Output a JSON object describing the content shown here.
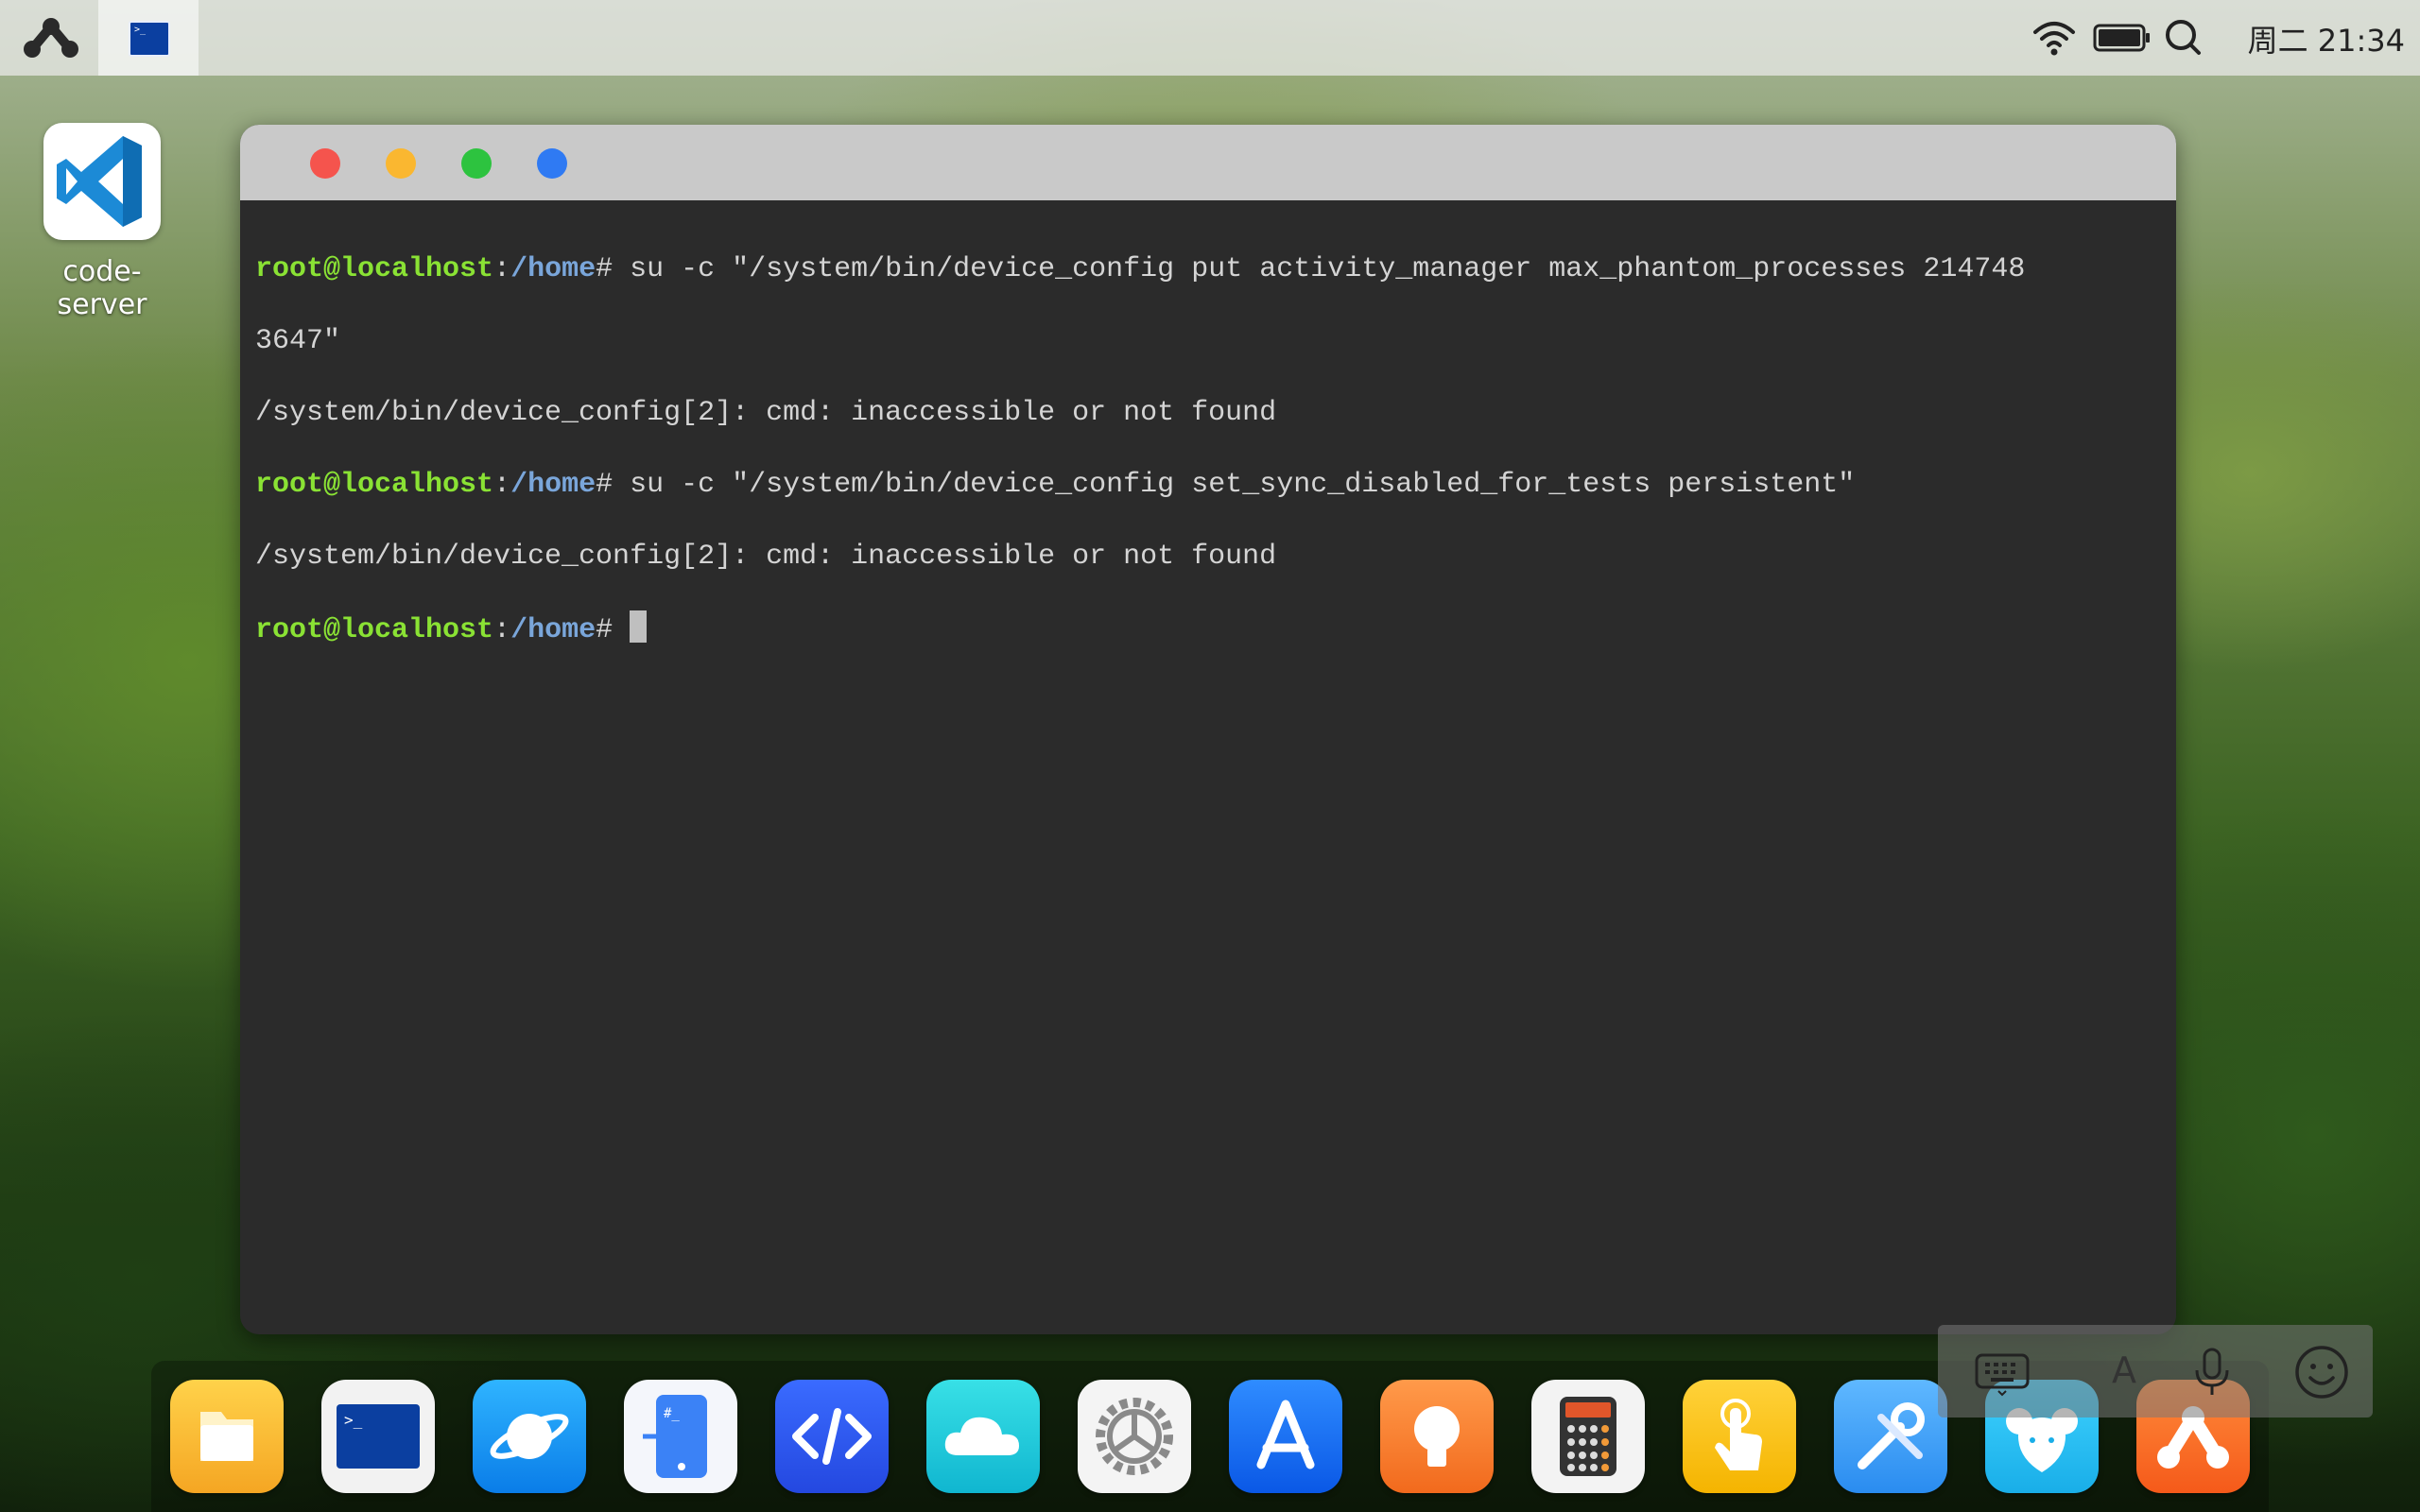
{
  "taskbar": {
    "launcher_icon": "launcher-icon",
    "active_task": "terminal-task-icon",
    "tray": {
      "wifi_icon": "wifi-icon",
      "battery_icon": "battery-icon",
      "search_icon": "search-icon",
      "clock": "周二 21:34"
    }
  },
  "desktop": {
    "icons": [
      {
        "label": "code-server",
        "icon": "vscode-icon"
      }
    ]
  },
  "terminal": {
    "window_buttons": [
      "close",
      "minimize",
      "maximize",
      "fullscreen"
    ],
    "prompt_user": "root@localhost",
    "prompt_sep": ":",
    "prompt_path": "/home",
    "prompt_end": "# ",
    "lines": [
      {
        "type": "cmd",
        "text": "su -c \"/system/bin/device_config put activity_manager max_phantom_processes 214748"
      },
      {
        "type": "out",
        "text": "3647\""
      },
      {
        "type": "out",
        "text": "/system/bin/device_config[2]: cmd: inaccessible or not found"
      },
      {
        "type": "cmd",
        "text": "su -c \"/system/bin/device_config set_sync_disabled_for_tests persistent\""
      },
      {
        "type": "out",
        "text": "/system/bin/device_config[2]: cmd: inaccessible or not found"
      },
      {
        "type": "prompt",
        "text": ""
      }
    ]
  },
  "keyboard_toolbar": {
    "items": [
      "keyboard-icon",
      "font-icon",
      "microphone-icon",
      "emoji-icon"
    ],
    "font_label": "A"
  },
  "dock": {
    "apps": [
      "files-icon",
      "terminal-icon",
      "browser-icon",
      "shell-app-icon",
      "code-editor-icon",
      "cloud-icon",
      "settings-icon",
      "app-store-icon",
      "tips-icon",
      "calculator-icon",
      "touch-icon",
      "tools-icon",
      "mouse-icon",
      "launcher-app-icon"
    ]
  }
}
